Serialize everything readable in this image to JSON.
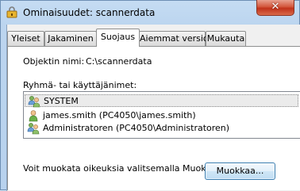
{
  "window": {
    "title": "Ominaisuudet: scannerdata",
    "close_label": "✕"
  },
  "tabs": [
    {
      "label": "Yleiset",
      "active": false
    },
    {
      "label": "Jakaminen",
      "active": false
    },
    {
      "label": "Suojaus",
      "active": true
    },
    {
      "label": "Aiemmat versiot",
      "active": false
    },
    {
      "label": "Mukauta",
      "active": false
    }
  ],
  "security": {
    "object_name_label": "Objektin nimi:",
    "object_name_value": "C:\\scannerdata",
    "groups_label": "Ryhmä- tai käyttäjänimet:",
    "principals": [
      {
        "name": "SYSTEM",
        "icon": "group-users-icon",
        "selected": true
      },
      {
        "name": "james.smith (PC4050\\james.smith)",
        "icon": "user-icon",
        "selected": false
      },
      {
        "name": "Administratoren (PC4050\\Administratoren)",
        "icon": "group-users-icon",
        "selected": false
      }
    ],
    "edit_hint": "Voit muokata oikeuksia valitsemalla Muokkaa.",
    "edit_button": "Muokkaa..."
  },
  "colors": {
    "accent": "#3c7fb1",
    "close_red": "#c0321a",
    "selection": "#ebebeb"
  }
}
